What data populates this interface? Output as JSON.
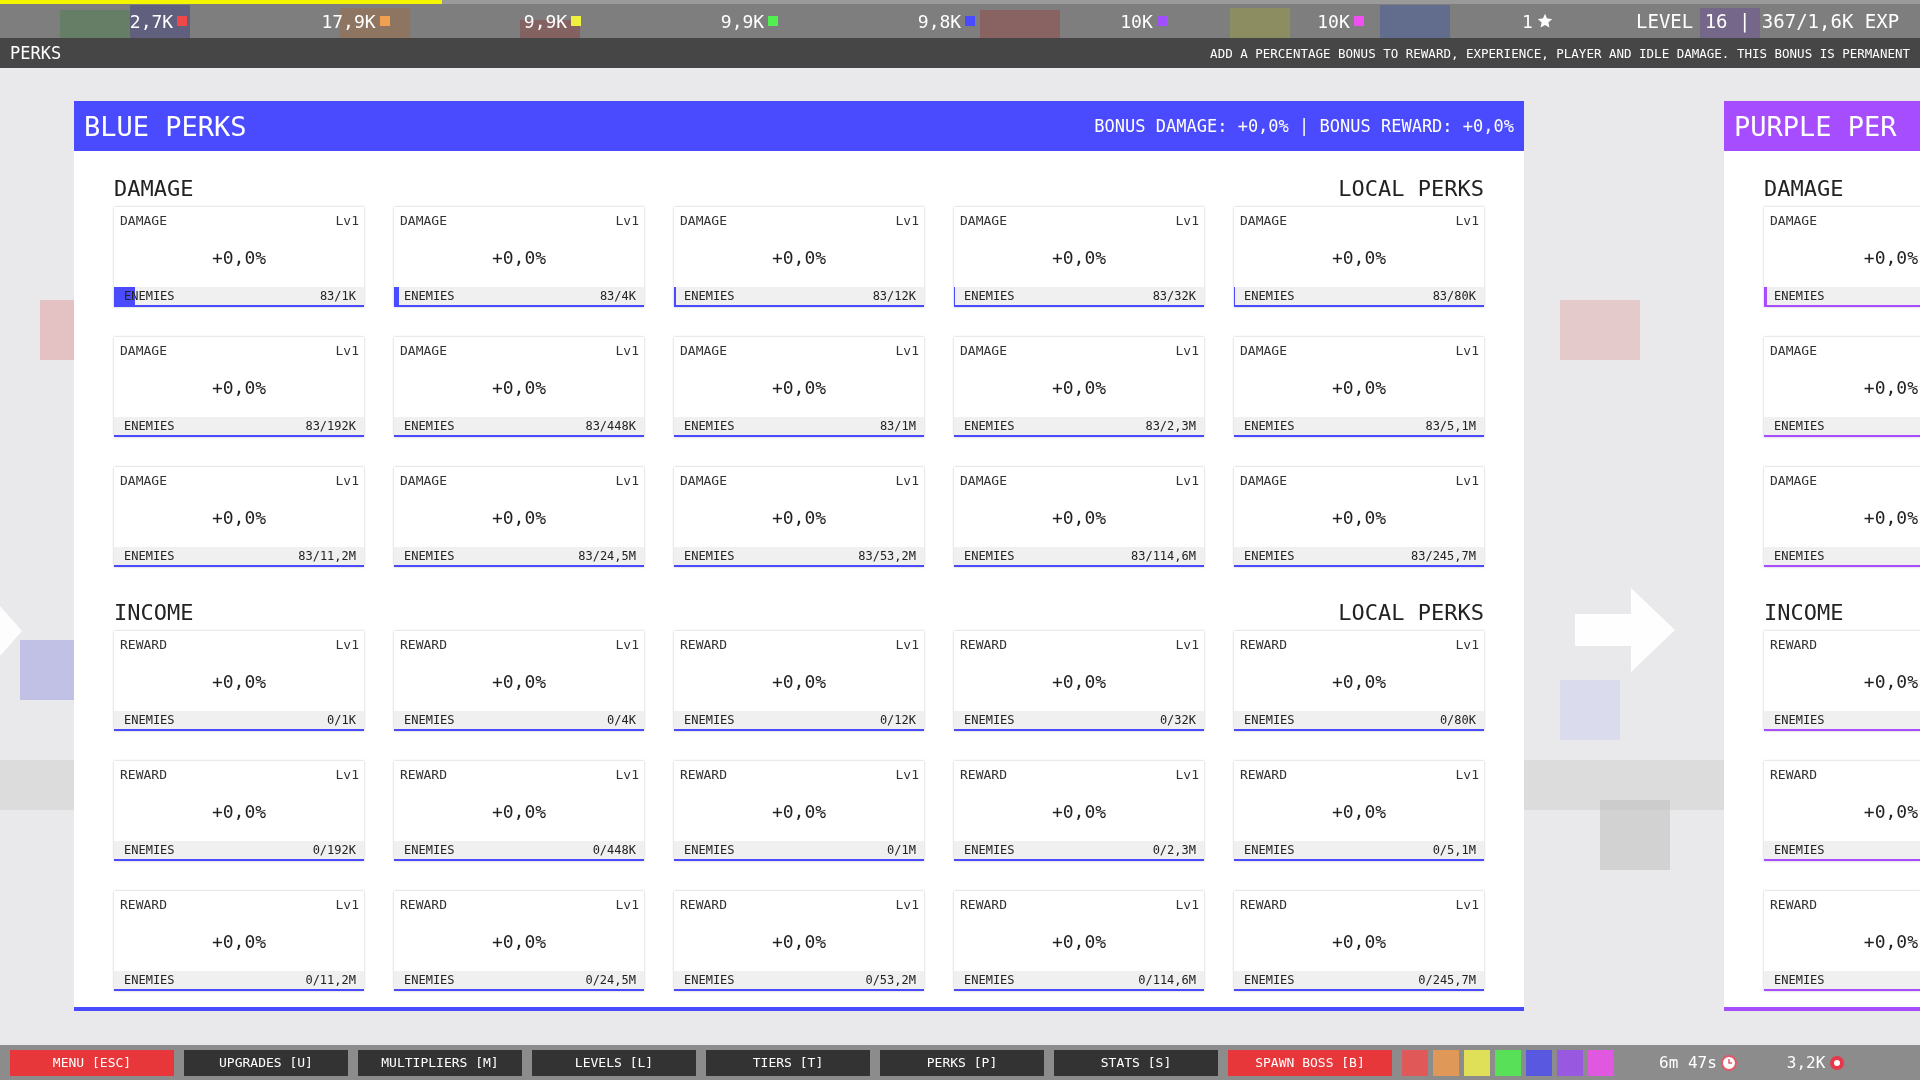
{
  "exp_bar": {
    "level": 0.23
  },
  "resources": [
    {
      "value": "2,7K",
      "color": "#f04848"
    },
    {
      "value": "17,9K",
      "color": "#f0a050"
    },
    {
      "value": "9,9K",
      "color": "#f0f040"
    },
    {
      "value": "9,9K",
      "color": "#50f050"
    },
    {
      "value": "9,8K",
      "color": "#4a4aff"
    },
    {
      "value": "10K",
      "color": "#a050ff"
    },
    {
      "value": "10K",
      "color": "#f050f0"
    }
  ],
  "stars": "1",
  "level_text": "LEVEL 16 | 367/1,6K EXP",
  "page": {
    "title": "PERKS",
    "description": "ADD A PERCENTAGE BONUS TO REWARD, EXPERIENCE, PLAYER AND IDLE DAMAGE. THIS BONUS IS PERMANENT"
  },
  "panels": [
    {
      "title": "BLUE PERKS",
      "color": "#4a4aff",
      "bonus": "BONUS DAMAGE: +0,0% | BONUS REWARD: +0,0%",
      "sections": [
        {
          "title": "DAMAGE",
          "subtitle": "LOCAL PERKS",
          "cards": [
            {
              "label": "DAMAGE",
              "lv": "Lv1",
              "value": "+0,0%",
              "progress_label": "ENEMIES",
              "count": "83/1K",
              "level": 0.083
            },
            {
              "label": "DAMAGE",
              "lv": "Lv1",
              "value": "+0,0%",
              "progress_label": "ENEMIES",
              "count": "83/4K",
              "level": 0.021
            },
            {
              "label": "DAMAGE",
              "lv": "Lv1",
              "value": "+0,0%",
              "progress_label": "ENEMIES",
              "count": "83/12K",
              "level": 0.007
            },
            {
              "label": "DAMAGE",
              "lv": "Lv1",
              "value": "+0,0%",
              "progress_label": "ENEMIES",
              "count": "83/32K",
              "level": 0.003
            },
            {
              "label": "DAMAGE",
              "lv": "Lv1",
              "value": "+0,0%",
              "progress_label": "ENEMIES",
              "count": "83/80K",
              "level": 0.001
            },
            {
              "label": "DAMAGE",
              "lv": "Lv1",
              "value": "+0,0%",
              "progress_label": "ENEMIES",
              "count": "83/192K"
            },
            {
              "label": "DAMAGE",
              "lv": "Lv1",
              "value": "+0,0%",
              "progress_label": "ENEMIES",
              "count": "83/448K"
            },
            {
              "label": "DAMAGE",
              "lv": "Lv1",
              "value": "+0,0%",
              "progress_label": "ENEMIES",
              "count": "83/1M"
            },
            {
              "label": "DAMAGE",
              "lv": "Lv1",
              "value": "+0,0%",
              "progress_label": "ENEMIES",
              "count": "83/2,3M"
            },
            {
              "label": "DAMAGE",
              "lv": "Lv1",
              "value": "+0,0%",
              "progress_label": "ENEMIES",
              "count": "83/5,1M"
            },
            {
              "label": "DAMAGE",
              "lv": "Lv1",
              "value": "+0,0%",
              "progress_label": "ENEMIES",
              "count": "83/11,2M"
            },
            {
              "label": "DAMAGE",
              "lv": "Lv1",
              "value": "+0,0%",
              "progress_label": "ENEMIES",
              "count": "83/24,5M"
            },
            {
              "label": "DAMAGE",
              "lv": "Lv1",
              "value": "+0,0%",
              "progress_label": "ENEMIES",
              "count": "83/53,2M"
            },
            {
              "label": "DAMAGE",
              "lv": "Lv1",
              "value": "+0,0%",
              "progress_label": "ENEMIES",
              "count": "83/114,6M"
            },
            {
              "label": "DAMAGE",
              "lv": "Lv1",
              "value": "+0,0%",
              "progress_label": "ENEMIES",
              "count": "83/245,7M"
            }
          ]
        },
        {
          "title": "INCOME",
          "subtitle": "LOCAL PERKS",
          "cards": [
            {
              "label": "REWARD",
              "lv": "Lv1",
              "value": "+0,0%",
              "progress_label": "ENEMIES",
              "count": "0/1K"
            },
            {
              "label": "REWARD",
              "lv": "Lv1",
              "value": "+0,0%",
              "progress_label": "ENEMIES",
              "count": "0/4K"
            },
            {
              "label": "REWARD",
              "lv": "Lv1",
              "value": "+0,0%",
              "progress_label": "ENEMIES",
              "count": "0/12K"
            },
            {
              "label": "REWARD",
              "lv": "Lv1",
              "value": "+0,0%",
              "progress_label": "ENEMIES",
              "count": "0/32K"
            },
            {
              "label": "REWARD",
              "lv": "Lv1",
              "value": "+0,0%",
              "progress_label": "ENEMIES",
              "count": "0/80K"
            },
            {
              "label": "REWARD",
              "lv": "Lv1",
              "value": "+0,0%",
              "progress_label": "ENEMIES",
              "count": "0/192K"
            },
            {
              "label": "REWARD",
              "lv": "Lv1",
              "value": "+0,0%",
              "progress_label": "ENEMIES",
              "count": "0/448K"
            },
            {
              "label": "REWARD",
              "lv": "Lv1",
              "value": "+0,0%",
              "progress_label": "ENEMIES",
              "count": "0/1M"
            },
            {
              "label": "REWARD",
              "lv": "Lv1",
              "value": "+0,0%",
              "progress_label": "ENEMIES",
              "count": "0/2,3M"
            },
            {
              "label": "REWARD",
              "lv": "Lv1",
              "value": "+0,0%",
              "progress_label": "ENEMIES",
              "count": "0/5,1M"
            },
            {
              "label": "REWARD",
              "lv": "Lv1",
              "value": "+0,0%",
              "progress_label": "ENEMIES",
              "count": "0/11,2M"
            },
            {
              "label": "REWARD",
              "lv": "Lv1",
              "value": "+0,0%",
              "progress_label": "ENEMIES",
              "count": "0/24,5M"
            },
            {
              "label": "REWARD",
              "lv": "Lv1",
              "value": "+0,0%",
              "progress_label": "ENEMIES",
              "count": "0/53,2M"
            },
            {
              "label": "REWARD",
              "lv": "Lv1",
              "value": "+0,0%",
              "progress_label": "ENEMIES",
              "count": "0/114,6M"
            },
            {
              "label": "REWARD",
              "lv": "Lv1",
              "value": "+0,0%",
              "progress_label": "ENEMIES",
              "count": "0/245,7M"
            }
          ]
        }
      ]
    },
    {
      "title": "PURPLE PER",
      "color": "#a64dff",
      "sections": [
        {
          "title": "DAMAGE",
          "cards": [
            {
              "label": "DAMAGE",
              "value": "+0,0%",
              "progress_label": "ENEMIES",
              "level": 0.02
            },
            {
              "label": "DAMAGE",
              "value": "+0,0%",
              "progress_label": "ENEMIES"
            },
            {
              "label": "DAMAGE",
              "value": "+0,0%",
              "progress_label": "ENEMIES"
            }
          ]
        },
        {
          "title": "INCOME",
          "cards": [
            {
              "label": "REWARD",
              "value": "+0,0%",
              "progress_label": "ENEMIES"
            },
            {
              "label": "REWARD",
              "value": "+0,0%",
              "progress_label": "ENEMIES"
            },
            {
              "label": "REWARD",
              "value": "+0,0%",
              "progress_label": "ENEMIES"
            }
          ]
        }
      ]
    }
  ],
  "bottom_bar": {
    "buttons": [
      {
        "label": "MENU [ESC]",
        "kind": "danger"
      },
      {
        "label": "UPGRADES [U]",
        "kind": "normal"
      },
      {
        "label": "MULTIPLIERS [M]",
        "kind": "normal"
      },
      {
        "label": "LEVELS [L]",
        "kind": "normal"
      },
      {
        "label": "TIERS [T]",
        "kind": "normal"
      },
      {
        "label": "PERKS [P]",
        "kind": "normal"
      },
      {
        "label": "STATS [S]",
        "kind": "normal"
      },
      {
        "label": "SPAWN BOSS [B]",
        "kind": "danger"
      }
    ],
    "swatches": [
      {
        "color": "#e05858"
      },
      {
        "color": "#e09858"
      },
      {
        "color": "#e0e058"
      },
      {
        "color": "#58e058"
      },
      {
        "color": "#5858e0"
      },
      {
        "color": "#9858e0"
      },
      {
        "color": "#e058e0"
      }
    ],
    "timer": "6m 47s",
    "boss_count": "3,2K"
  }
}
